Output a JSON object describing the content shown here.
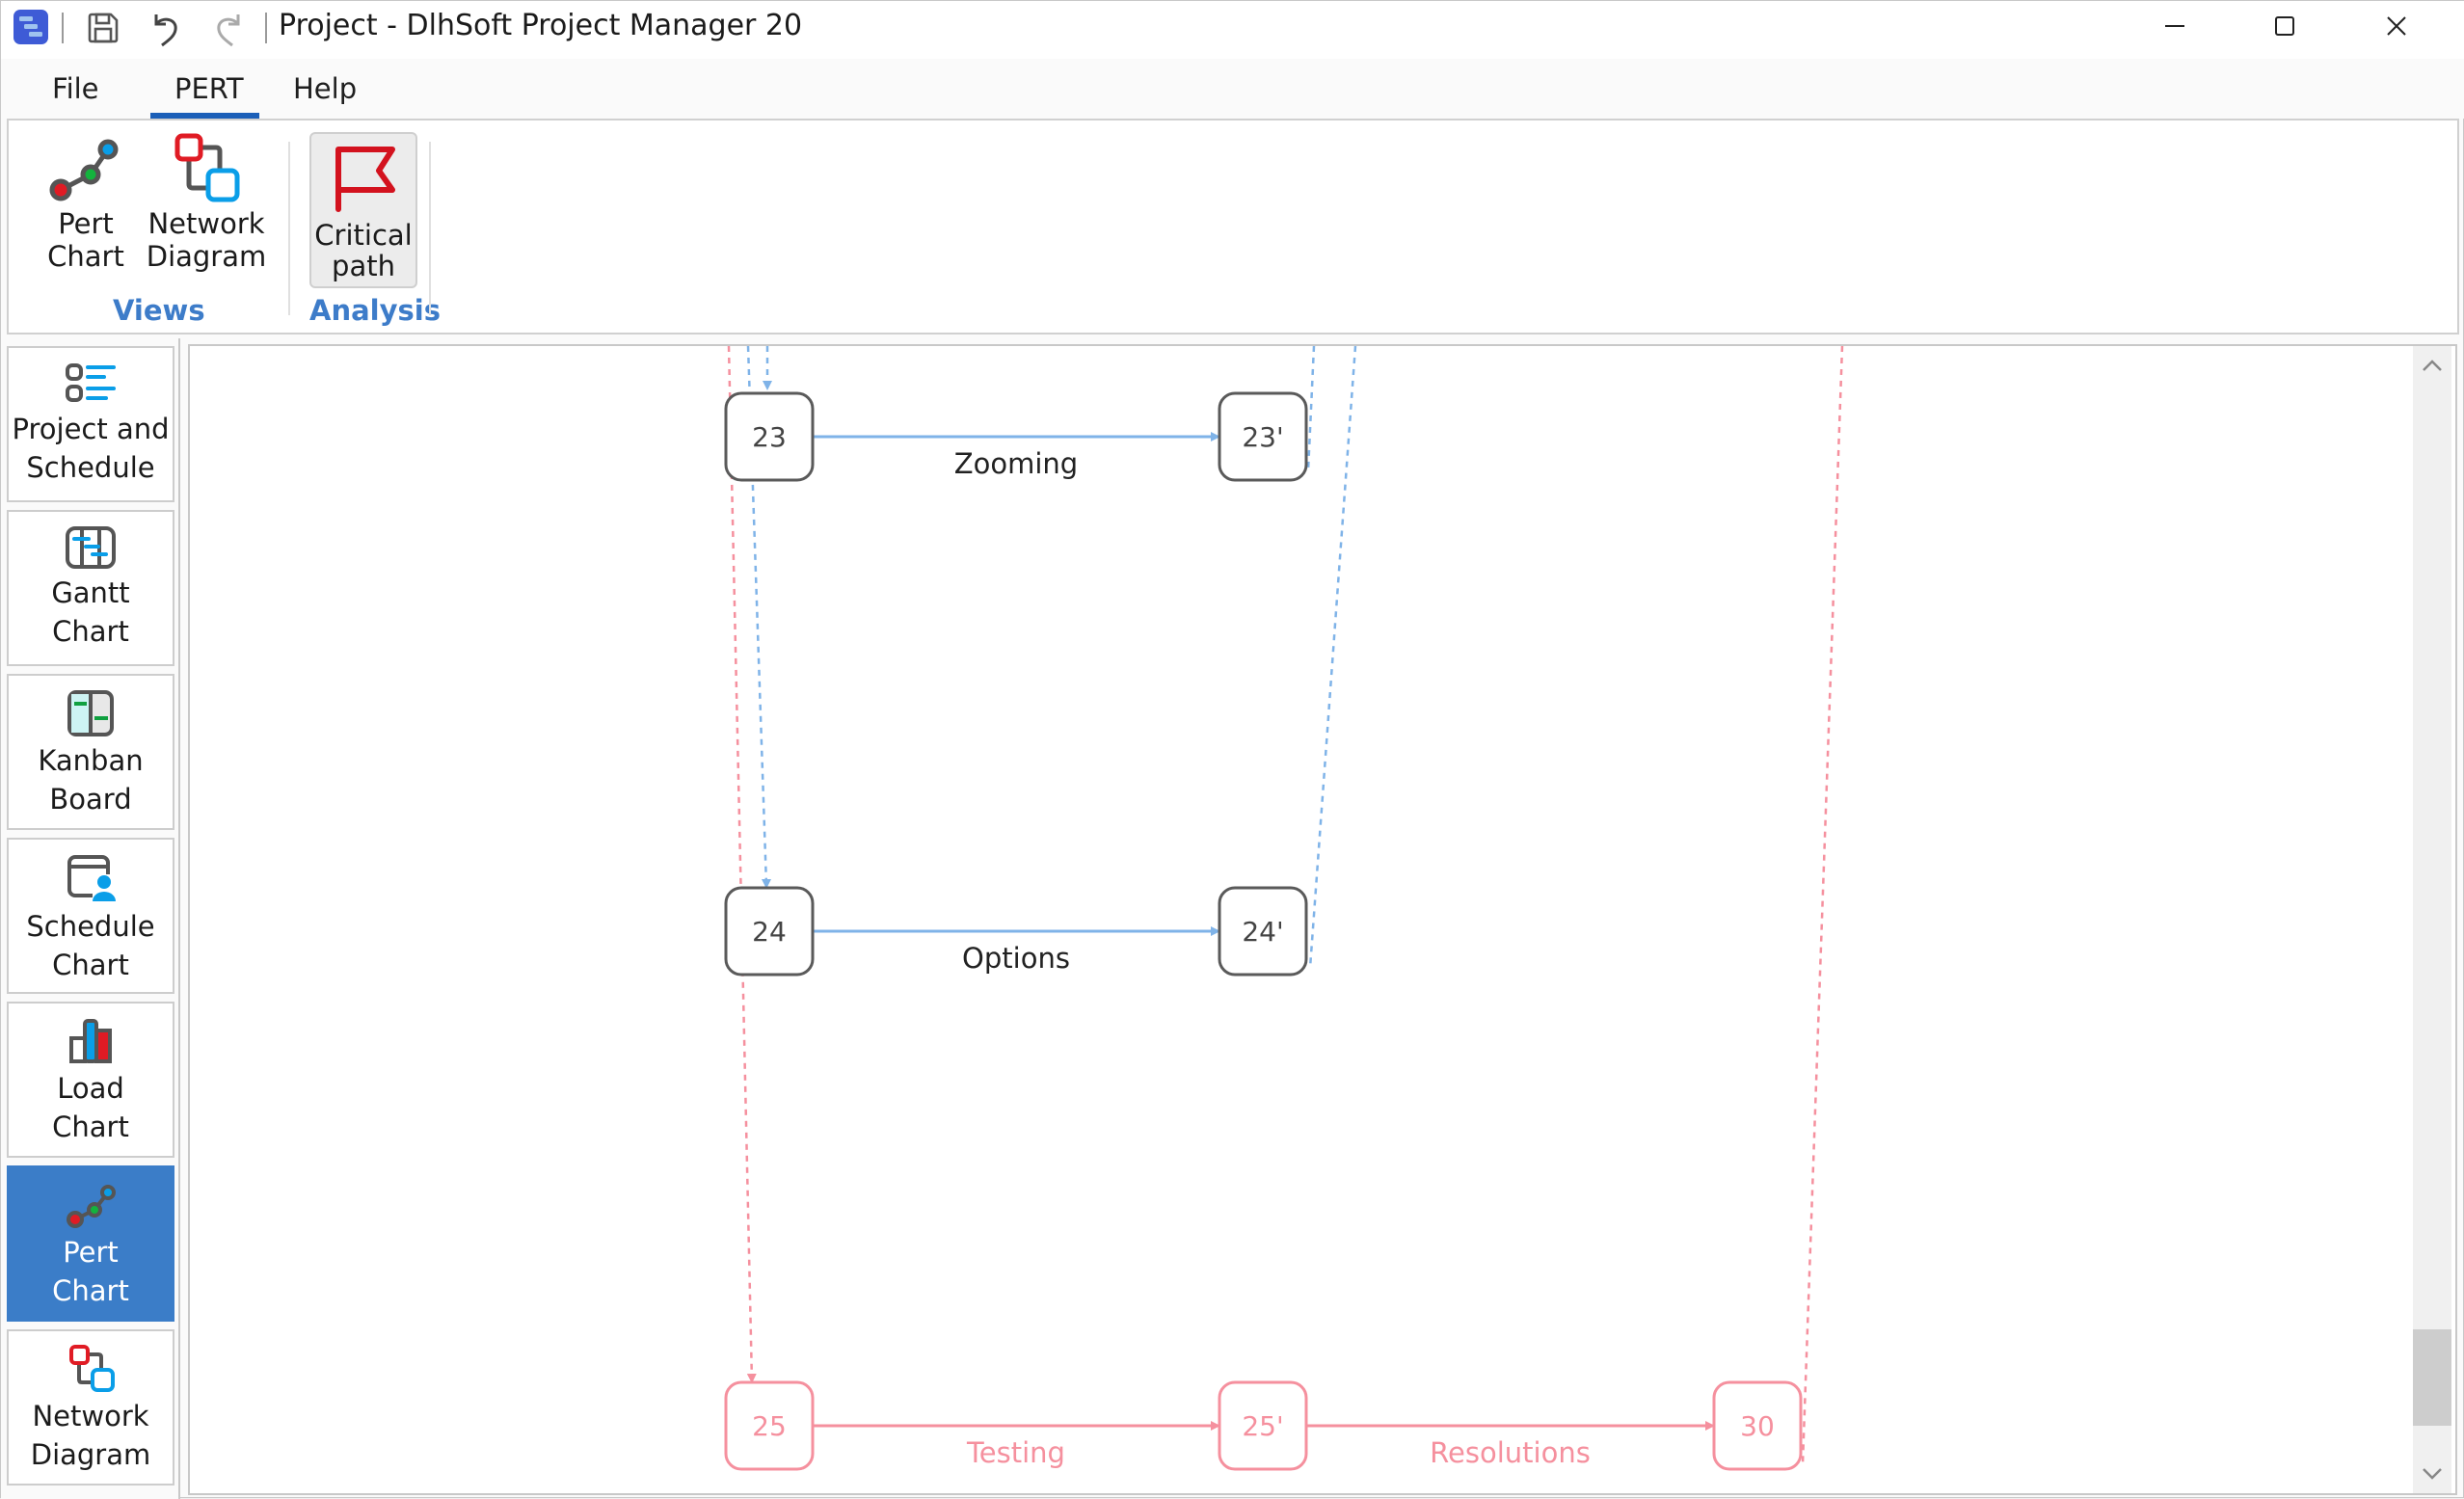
{
  "window": {
    "title": "Project - DlhSoft Project Manager 20",
    "controls": {
      "minimize": "minimize",
      "maximize": "maximize",
      "close": "close"
    }
  },
  "quick_access": {
    "icons": [
      "app-icon",
      "save-icon",
      "undo-icon",
      "redo-icon"
    ]
  },
  "menu": {
    "tabs": [
      {
        "label": "File",
        "active": false
      },
      {
        "label": "PERT",
        "active": true
      },
      {
        "label": "Help",
        "active": false
      }
    ]
  },
  "ribbon": {
    "groups": [
      {
        "label": "Views",
        "buttons": [
          {
            "line1": "Pert",
            "line2": "Chart",
            "icon": "pert-chart-icon"
          },
          {
            "line1": "Network",
            "line2": "Diagram",
            "icon": "network-diagram-icon"
          }
        ]
      },
      {
        "label": "Analysis",
        "buttons": [
          {
            "line1": "Critical",
            "line2": "path",
            "icon": "flag-icon",
            "toggled": true
          }
        ]
      }
    ]
  },
  "sidebar": {
    "items": [
      {
        "line1": "Project and",
        "line2": "Schedule",
        "icon": "project-schedule-icon",
        "active": false
      },
      {
        "line1": "Gantt",
        "line2": "Chart",
        "icon": "gantt-chart-icon",
        "active": false
      },
      {
        "line1": "Kanban",
        "line2": "Board",
        "icon": "kanban-board-icon",
        "active": false
      },
      {
        "line1": "Schedule",
        "line2": "Chart",
        "icon": "schedule-chart-icon",
        "active": false
      },
      {
        "line1": "Load",
        "line2": "Chart",
        "icon": "load-chart-icon",
        "active": false
      },
      {
        "line1": "Pert",
        "line2": "Chart",
        "icon": "pert-chart-icon",
        "active": true
      },
      {
        "line1": "Network",
        "line2": "Diagram",
        "icon": "network-diagram-icon",
        "active": false
      }
    ]
  },
  "pert": {
    "colors": {
      "normal_stroke": "#5a5a5a",
      "normal_link": "#7fb3e8",
      "critical": "#f5909e",
      "text": "#444444"
    },
    "nodes": [
      {
        "id": "23",
        "label": "23",
        "critical": false
      },
      {
        "id": "23p",
        "label": "23'",
        "critical": false
      },
      {
        "id": "24",
        "label": "24",
        "critical": false
      },
      {
        "id": "24p",
        "label": "24'",
        "critical": false
      },
      {
        "id": "25",
        "label": "25",
        "critical": true
      },
      {
        "id": "25p",
        "label": "25'",
        "critical": true
      },
      {
        "id": "30",
        "label": "30",
        "critical": true
      }
    ],
    "tasks": [
      {
        "from": "23",
        "to": "23p",
        "label": "Zooming",
        "critical": false
      },
      {
        "from": "24",
        "to": "24p",
        "label": "Options",
        "critical": false
      },
      {
        "from": "25",
        "to": "25p",
        "label": "Testing",
        "critical": true
      },
      {
        "from": "25p",
        "to": "30",
        "label": "Resolutions",
        "critical": true
      }
    ]
  },
  "scrollbar": {
    "vertical_position": 0.97
  }
}
